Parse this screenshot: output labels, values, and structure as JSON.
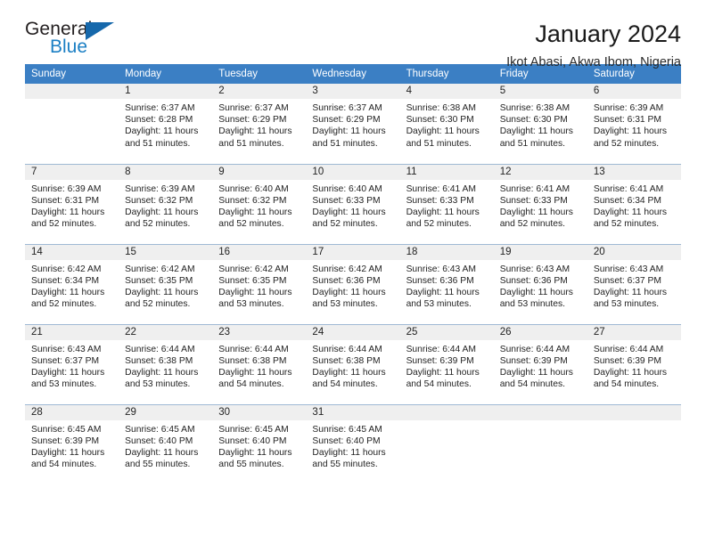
{
  "logo": {
    "word_top": "General",
    "word_bottom": "Blue",
    "accent_color": "#1668ab",
    "blue_text_color": "#1b7fc4"
  },
  "header": {
    "title": "January 2024",
    "subtitle": "Ikot Abasi, Akwa Ibom, Nigeria"
  },
  "theme": {
    "header_blue": "#3b7fc4",
    "daynum_band": "#efefef",
    "row_divider": "#9fb9d4"
  },
  "weekday_headers": [
    "Sunday",
    "Monday",
    "Tuesday",
    "Wednesday",
    "Thursday",
    "Friday",
    "Saturday"
  ],
  "weeks": [
    [
      {
        "day": "",
        "sunrise": "",
        "sunset": "",
        "daylight_line1": "",
        "daylight_line2": ""
      },
      {
        "day": "1",
        "sunrise": "Sunrise: 6:37 AM",
        "sunset": "Sunset: 6:28 PM",
        "daylight_line1": "Daylight: 11 hours",
        "daylight_line2": "and 51 minutes."
      },
      {
        "day": "2",
        "sunrise": "Sunrise: 6:37 AM",
        "sunset": "Sunset: 6:29 PM",
        "daylight_line1": "Daylight: 11 hours",
        "daylight_line2": "and 51 minutes."
      },
      {
        "day": "3",
        "sunrise": "Sunrise: 6:37 AM",
        "sunset": "Sunset: 6:29 PM",
        "daylight_line1": "Daylight: 11 hours",
        "daylight_line2": "and 51 minutes."
      },
      {
        "day": "4",
        "sunrise": "Sunrise: 6:38 AM",
        "sunset": "Sunset: 6:30 PM",
        "daylight_line1": "Daylight: 11 hours",
        "daylight_line2": "and 51 minutes."
      },
      {
        "day": "5",
        "sunrise": "Sunrise: 6:38 AM",
        "sunset": "Sunset: 6:30 PM",
        "daylight_line1": "Daylight: 11 hours",
        "daylight_line2": "and 51 minutes."
      },
      {
        "day": "6",
        "sunrise": "Sunrise: 6:39 AM",
        "sunset": "Sunset: 6:31 PM",
        "daylight_line1": "Daylight: 11 hours",
        "daylight_line2": "and 52 minutes."
      }
    ],
    [
      {
        "day": "7",
        "sunrise": "Sunrise: 6:39 AM",
        "sunset": "Sunset: 6:31 PM",
        "daylight_line1": "Daylight: 11 hours",
        "daylight_line2": "and 52 minutes."
      },
      {
        "day": "8",
        "sunrise": "Sunrise: 6:39 AM",
        "sunset": "Sunset: 6:32 PM",
        "daylight_line1": "Daylight: 11 hours",
        "daylight_line2": "and 52 minutes."
      },
      {
        "day": "9",
        "sunrise": "Sunrise: 6:40 AM",
        "sunset": "Sunset: 6:32 PM",
        "daylight_line1": "Daylight: 11 hours",
        "daylight_line2": "and 52 minutes."
      },
      {
        "day": "10",
        "sunrise": "Sunrise: 6:40 AM",
        "sunset": "Sunset: 6:33 PM",
        "daylight_line1": "Daylight: 11 hours",
        "daylight_line2": "and 52 minutes."
      },
      {
        "day": "11",
        "sunrise": "Sunrise: 6:41 AM",
        "sunset": "Sunset: 6:33 PM",
        "daylight_line1": "Daylight: 11 hours",
        "daylight_line2": "and 52 minutes."
      },
      {
        "day": "12",
        "sunrise": "Sunrise: 6:41 AM",
        "sunset": "Sunset: 6:33 PM",
        "daylight_line1": "Daylight: 11 hours",
        "daylight_line2": "and 52 minutes."
      },
      {
        "day": "13",
        "sunrise": "Sunrise: 6:41 AM",
        "sunset": "Sunset: 6:34 PM",
        "daylight_line1": "Daylight: 11 hours",
        "daylight_line2": "and 52 minutes."
      }
    ],
    [
      {
        "day": "14",
        "sunrise": "Sunrise: 6:42 AM",
        "sunset": "Sunset: 6:34 PM",
        "daylight_line1": "Daylight: 11 hours",
        "daylight_line2": "and 52 minutes."
      },
      {
        "day": "15",
        "sunrise": "Sunrise: 6:42 AM",
        "sunset": "Sunset: 6:35 PM",
        "daylight_line1": "Daylight: 11 hours",
        "daylight_line2": "and 52 minutes."
      },
      {
        "day": "16",
        "sunrise": "Sunrise: 6:42 AM",
        "sunset": "Sunset: 6:35 PM",
        "daylight_line1": "Daylight: 11 hours",
        "daylight_line2": "and 53 minutes."
      },
      {
        "day": "17",
        "sunrise": "Sunrise: 6:42 AM",
        "sunset": "Sunset: 6:36 PM",
        "daylight_line1": "Daylight: 11 hours",
        "daylight_line2": "and 53 minutes."
      },
      {
        "day": "18",
        "sunrise": "Sunrise: 6:43 AM",
        "sunset": "Sunset: 6:36 PM",
        "daylight_line1": "Daylight: 11 hours",
        "daylight_line2": "and 53 minutes."
      },
      {
        "day": "19",
        "sunrise": "Sunrise: 6:43 AM",
        "sunset": "Sunset: 6:36 PM",
        "daylight_line1": "Daylight: 11 hours",
        "daylight_line2": "and 53 minutes."
      },
      {
        "day": "20",
        "sunrise": "Sunrise: 6:43 AM",
        "sunset": "Sunset: 6:37 PM",
        "daylight_line1": "Daylight: 11 hours",
        "daylight_line2": "and 53 minutes."
      }
    ],
    [
      {
        "day": "21",
        "sunrise": "Sunrise: 6:43 AM",
        "sunset": "Sunset: 6:37 PM",
        "daylight_line1": "Daylight: 11 hours",
        "daylight_line2": "and 53 minutes."
      },
      {
        "day": "22",
        "sunrise": "Sunrise: 6:44 AM",
        "sunset": "Sunset: 6:38 PM",
        "daylight_line1": "Daylight: 11 hours",
        "daylight_line2": "and 53 minutes."
      },
      {
        "day": "23",
        "sunrise": "Sunrise: 6:44 AM",
        "sunset": "Sunset: 6:38 PM",
        "daylight_line1": "Daylight: 11 hours",
        "daylight_line2": "and 54 minutes."
      },
      {
        "day": "24",
        "sunrise": "Sunrise: 6:44 AM",
        "sunset": "Sunset: 6:38 PM",
        "daylight_line1": "Daylight: 11 hours",
        "daylight_line2": "and 54 minutes."
      },
      {
        "day": "25",
        "sunrise": "Sunrise: 6:44 AM",
        "sunset": "Sunset: 6:39 PM",
        "daylight_line1": "Daylight: 11 hours",
        "daylight_line2": "and 54 minutes."
      },
      {
        "day": "26",
        "sunrise": "Sunrise: 6:44 AM",
        "sunset": "Sunset: 6:39 PM",
        "daylight_line1": "Daylight: 11 hours",
        "daylight_line2": "and 54 minutes."
      },
      {
        "day": "27",
        "sunrise": "Sunrise: 6:44 AM",
        "sunset": "Sunset: 6:39 PM",
        "daylight_line1": "Daylight: 11 hours",
        "daylight_line2": "and 54 minutes."
      }
    ],
    [
      {
        "day": "28",
        "sunrise": "Sunrise: 6:45 AM",
        "sunset": "Sunset: 6:39 PM",
        "daylight_line1": "Daylight: 11 hours",
        "daylight_line2": "and 54 minutes."
      },
      {
        "day": "29",
        "sunrise": "Sunrise: 6:45 AM",
        "sunset": "Sunset: 6:40 PM",
        "daylight_line1": "Daylight: 11 hours",
        "daylight_line2": "and 55 minutes."
      },
      {
        "day": "30",
        "sunrise": "Sunrise: 6:45 AM",
        "sunset": "Sunset: 6:40 PM",
        "daylight_line1": "Daylight: 11 hours",
        "daylight_line2": "and 55 minutes."
      },
      {
        "day": "31",
        "sunrise": "Sunrise: 6:45 AM",
        "sunset": "Sunset: 6:40 PM",
        "daylight_line1": "Daylight: 11 hours",
        "daylight_line2": "and 55 minutes."
      },
      {
        "day": "",
        "sunrise": "",
        "sunset": "",
        "daylight_line1": "",
        "daylight_line2": ""
      },
      {
        "day": "",
        "sunrise": "",
        "sunset": "",
        "daylight_line1": "",
        "daylight_line2": ""
      },
      {
        "day": "",
        "sunrise": "",
        "sunset": "",
        "daylight_line1": "",
        "daylight_line2": ""
      }
    ]
  ]
}
